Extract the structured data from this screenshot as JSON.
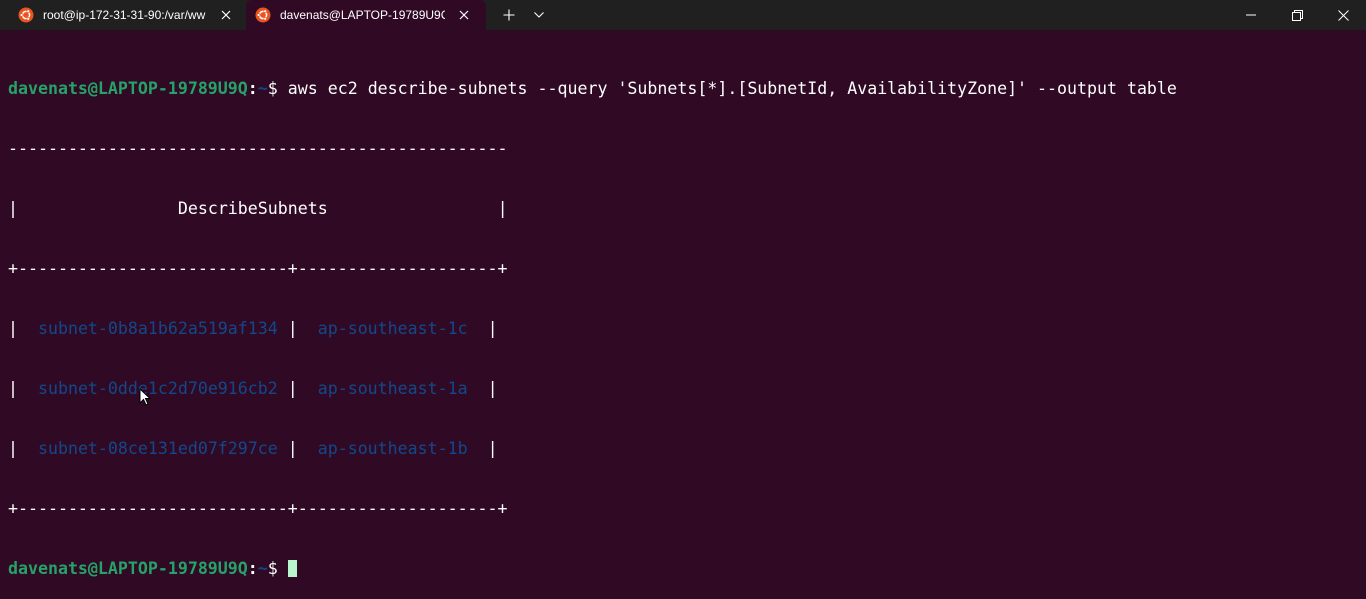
{
  "tabs": [
    {
      "title": "root@ip-172-31-31-90:/var/ww",
      "icon": "ubuntu-icon",
      "active": false
    },
    {
      "title": "davenats@LAPTOP-19789U9C",
      "icon": "ubuntu-icon",
      "active": true
    }
  ],
  "titlebar": {
    "new_tab": "+",
    "dropdown_icon": "chevron-down-icon",
    "minimize_icon": "minimize-icon",
    "maximize_icon": "restore-icon",
    "close_icon": "close-icon"
  },
  "prompt": {
    "user_host": "davenats@LAPTOP-19789U9Q",
    "colon": ":",
    "path": "~",
    "dollar": "$ "
  },
  "command": "aws ec2 describe-subnets --query 'Subnets[*].[SubnetId, AvailabilityZone]' --output table",
  "table": {
    "border_top": "--------------------------------------------------",
    "title_line_left": "|",
    "title": "DescribeSubnets",
    "title_line_right": "|",
    "separator": "+---------------------------+--------------------+",
    "rows": [
      {
        "subnet_id": "subnet-0b8a1b62a519af134",
        "az": "ap-southeast-1c"
      },
      {
        "subnet_id": "subnet-0dde1c2d70e916cb2",
        "az": "ap-southeast-1a"
      },
      {
        "subnet_id": "subnet-08ce131ed07f297ce",
        "az": "ap-southeast-1b"
      }
    ],
    "bottom": "+---------------------------+--------------------+"
  },
  "colors": {
    "background": "#300a24",
    "titlebar": "#202020",
    "prompt_user": "#26a269",
    "prompt_path": "#12488b",
    "table_values": "#12488b",
    "cursor": "#b9f5cd"
  }
}
